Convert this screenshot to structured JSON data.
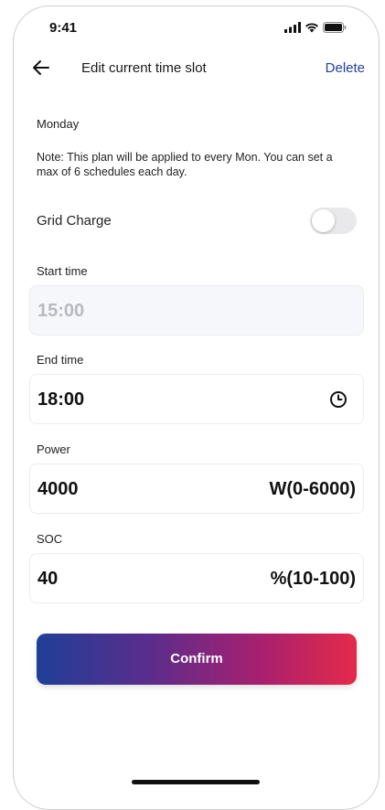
{
  "status_bar": {
    "time": "9:41",
    "icons": [
      "signal-icon",
      "wifi-icon",
      "battery-icon"
    ]
  },
  "header": {
    "back_icon": "arrow-left-icon",
    "title": "Edit current time slot",
    "delete_label": "Delete"
  },
  "schedule": {
    "day": "Monday",
    "note": "Note: This plan will be applied to every Mon. You can set a max of 6 schedules each day."
  },
  "grid_charge": {
    "label": "Grid Charge",
    "enabled": false
  },
  "fields": {
    "start_time": {
      "label": "Start time",
      "value": "15:00",
      "disabled": true
    },
    "end_time": {
      "label": "End time",
      "value": "18:00",
      "icon": "clock-icon"
    },
    "power": {
      "label": "Power",
      "value": "4000",
      "suffix": "W(0-6000)"
    },
    "soc": {
      "label": "SOC",
      "value": "40",
      "suffix": "%(10-100)"
    }
  },
  "confirm_label": "Confirm",
  "colors": {
    "accent_blue": "#22409a",
    "gradient_start": "#1f3f98",
    "gradient_end": "#e52a4a",
    "disabled_text": "#b8bac2"
  }
}
